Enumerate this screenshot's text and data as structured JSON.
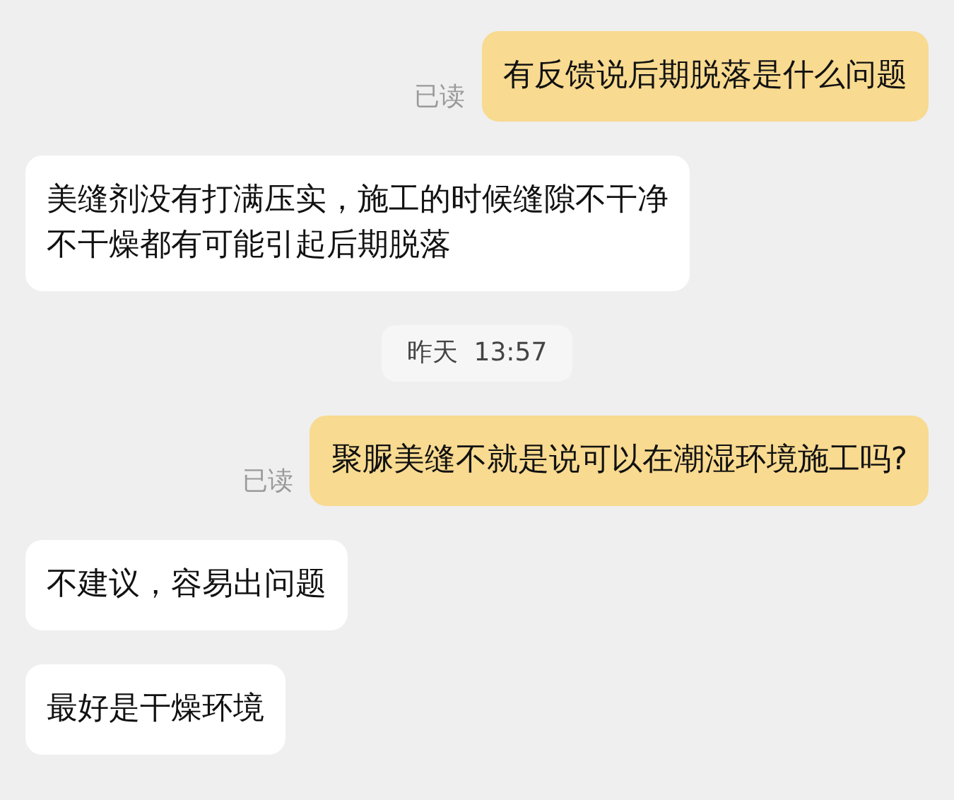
{
  "messages": [
    {
      "kind": "message",
      "outgoing": true,
      "text": "有反馈说后期脱落是什么问题",
      "status": "已读"
    },
    {
      "kind": "message",
      "outgoing": false,
      "text": "美缝剂没有打满压实，施工的时候缝隙不干净不干燥都有可能引起后期脱落"
    },
    {
      "kind": "time",
      "text": "昨天  13:57"
    },
    {
      "kind": "message",
      "outgoing": true,
      "text": "聚脲美缝不就是说可以在潮湿环境施工吗?",
      "status": "已读"
    },
    {
      "kind": "message",
      "outgoing": false,
      "text": "不建议，容易出问题"
    },
    {
      "kind": "message",
      "outgoing": false,
      "text": "最好是干燥环境"
    }
  ]
}
